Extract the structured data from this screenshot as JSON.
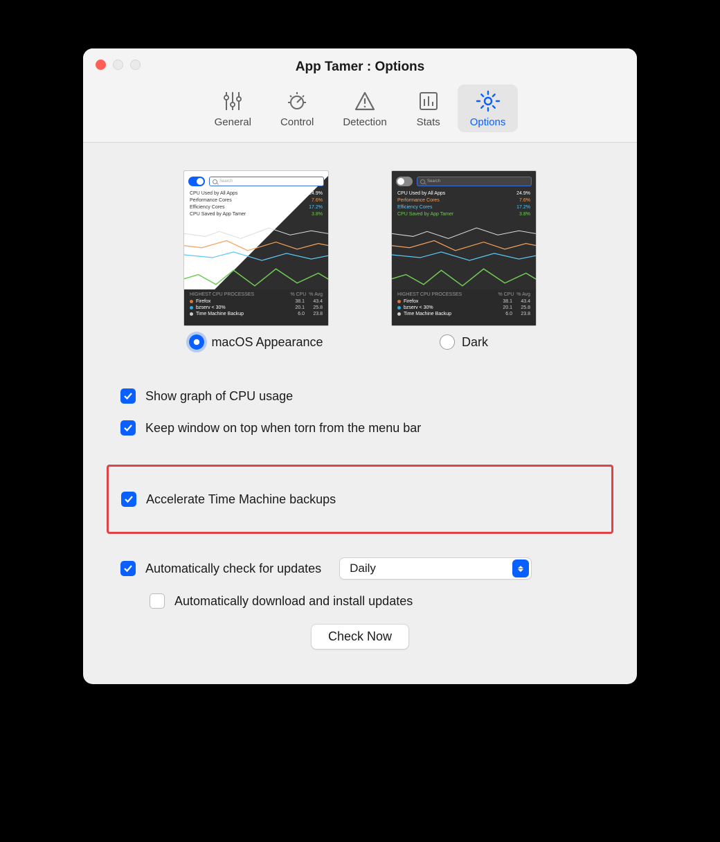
{
  "window": {
    "title": "App Tamer : Options"
  },
  "tabs": [
    {
      "id": "general",
      "label": "General"
    },
    {
      "id": "control",
      "label": "Control"
    },
    {
      "id": "detection",
      "label": "Detection"
    },
    {
      "id": "stats",
      "label": "Stats"
    },
    {
      "id": "options",
      "label": "Options"
    }
  ],
  "active_tab": "options",
  "theme": {
    "options": {
      "macos": "macOS Appearance",
      "dark": "Dark"
    },
    "selected": "macos"
  },
  "preview_stats": {
    "search_placeholder": "Search",
    "lines": [
      {
        "label": "CPU Used by All Apps",
        "value": "24.9%",
        "class": "sl-white"
      },
      {
        "label": "Performance Cores",
        "value": "7.6%",
        "class": "sl-orange"
      },
      {
        "label": "Efficiency Cores",
        "value": "17.2%",
        "class": "sl-cyan"
      },
      {
        "label": "CPU Saved by App Tamer",
        "value": "3.8%",
        "class": "sl-green"
      }
    ],
    "table_head": {
      "left": "HIGHEST CPU PROCESSES",
      "c1": "% CPU",
      "c2": "% Avg"
    },
    "rows": [
      {
        "dot": "r",
        "name": "Firefox",
        "v1": "38.1",
        "v2": "43.4"
      },
      {
        "dot": "b",
        "name": "bzserv < 30%",
        "v1": "20.1",
        "v2": "25.8"
      },
      {
        "dot": "w",
        "name": "Time Machine Backup",
        "v1": "6.0",
        "v2": "23.8"
      }
    ]
  },
  "checks": {
    "show_graph": {
      "label": "Show graph of CPU usage",
      "checked": true
    },
    "keep_on_top": {
      "label": "Keep window on top when torn from the menu bar",
      "checked": true
    },
    "accel_tm": {
      "label": "Accelerate Time Machine backups",
      "checked": true
    },
    "auto_check": {
      "label": "Automatically check for updates",
      "checked": true
    },
    "auto_download": {
      "label": "Automatically download and install updates",
      "checked": false
    }
  },
  "update_frequency": {
    "selected": "Daily"
  },
  "check_now_button": "Check Now"
}
